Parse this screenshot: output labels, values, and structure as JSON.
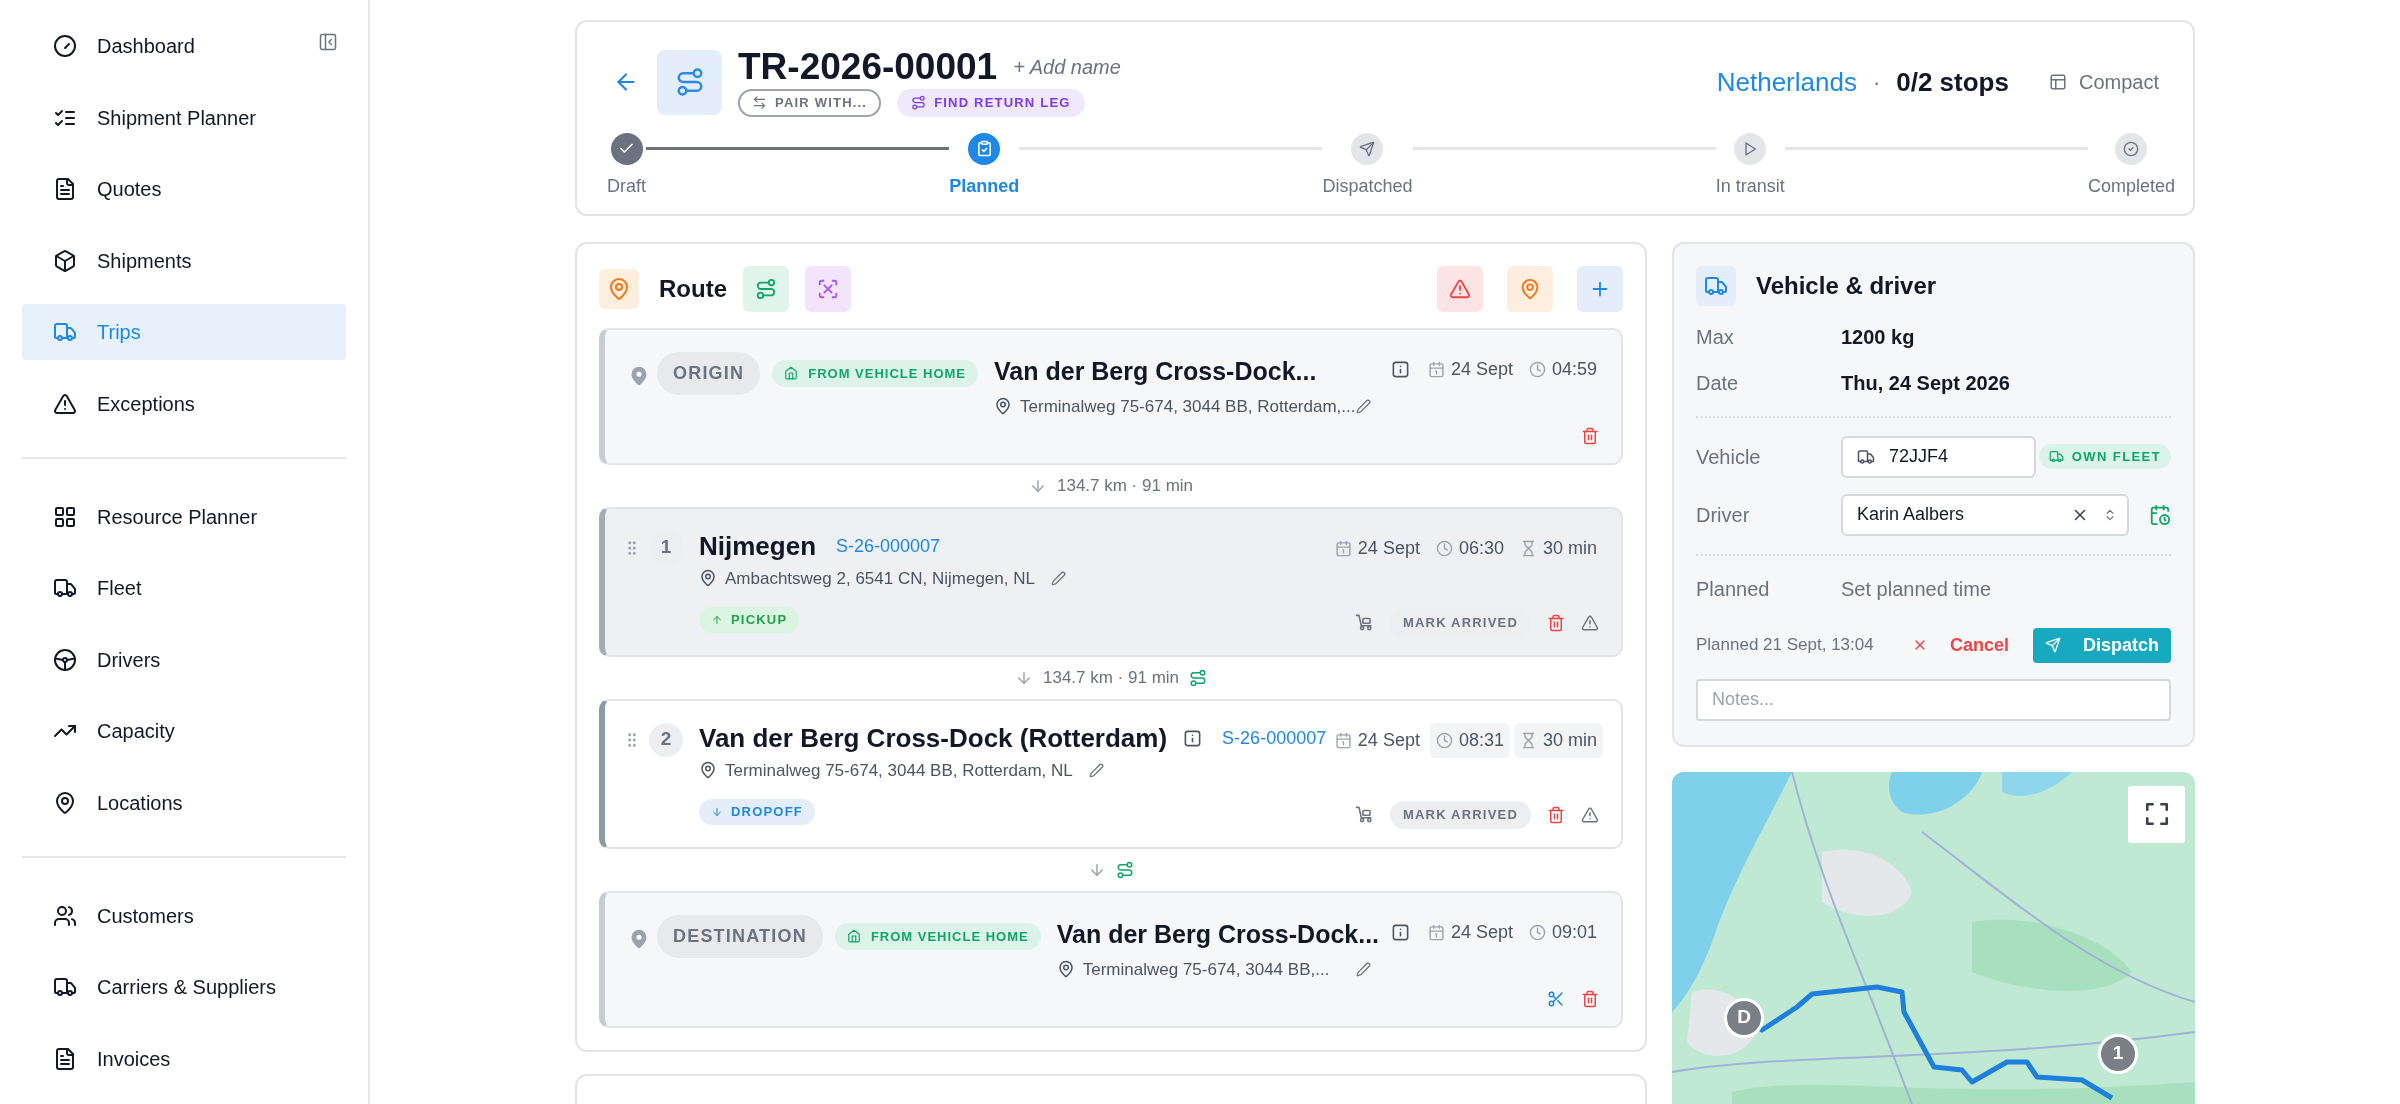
{
  "sidebar": {
    "collapse_button": true,
    "sections": [
      {
        "items": [
          {
            "label": "Dashboard",
            "selected": false
          },
          {
            "label": "Shipment Planner",
            "selected": false
          },
          {
            "label": "Quotes",
            "selected": false
          },
          {
            "label": "Shipments",
            "selected": false
          },
          {
            "label": "Trips",
            "selected": true
          },
          {
            "label": "Exceptions",
            "selected": false
          }
        ]
      },
      {
        "items": [
          {
            "label": "Resource Planner",
            "selected": false
          },
          {
            "label": "Fleet",
            "selected": false
          },
          {
            "label": "Drivers",
            "selected": false
          },
          {
            "label": "Capacity",
            "selected": false
          },
          {
            "label": "Locations",
            "selected": false
          }
        ]
      },
      {
        "items": [
          {
            "label": "Customers",
            "selected": false
          },
          {
            "label": "Carriers & Suppliers",
            "selected": false
          },
          {
            "label": "Invoices",
            "selected": false
          }
        ]
      }
    ]
  },
  "header": {
    "title": "TR-2026-00001",
    "add_name": "+ Add name",
    "pair_button": "PAIR WITH...",
    "return_leg_button": "FIND RETURN LEG",
    "region": "Netherlands",
    "separator": "·",
    "stops": "0/2 stops",
    "view_toggle": "Compact",
    "steps": [
      {
        "label": "Draft",
        "done": true,
        "selected": false
      },
      {
        "label": "Planned",
        "done": false,
        "selected": true
      },
      {
        "label": "Dispatched",
        "done": false,
        "selected": false
      },
      {
        "label": "In transit",
        "done": false,
        "selected": false
      },
      {
        "label": "Completed",
        "done": false,
        "selected": false
      }
    ]
  },
  "route": {
    "title": "Route",
    "items": [
      {
        "kind": "endpoint",
        "role": "ORIGIN",
        "source": "FROM VEHICLE HOME",
        "name": "Van der Berg Cross-Dock...",
        "address": "Terminalweg 75-674, 3044 BB, Rotterdam,...",
        "date": "24 Sept",
        "time": "04:59",
        "split": false
      },
      {
        "kind": "leg",
        "distance": "134.7 km · 91 min",
        "route_icon": false
      },
      {
        "kind": "stop",
        "number": "1",
        "name": "Nijmegen",
        "info": false,
        "shipment": "S-26-000007",
        "address": "Ambachtsweg 2, 6541 CN, Nijmegen, NL",
        "pickup": true,
        "type_label": "PICKUP",
        "date": "24 Sept",
        "time": "06:30",
        "duration": "30 min",
        "action": "MARK ARRIVED",
        "highlight": false
      },
      {
        "kind": "leg",
        "distance": "134.7 km · 91 min",
        "route_icon": true
      },
      {
        "kind": "stop",
        "number": "2",
        "name": "Van der Berg Cross-Dock (Rotterdam)",
        "info": true,
        "shipment": "S-26-000007",
        "address": "Terminalweg 75-674, 3044 BB, Rotterdam, NL",
        "pickup": false,
        "type_label": "DROPOFF",
        "date": "24 Sept",
        "time": "08:31",
        "duration": "30 min",
        "action": "MARK ARRIVED",
        "highlight": true
      },
      {
        "kind": "leg",
        "route_icon": true
      },
      {
        "kind": "endpoint",
        "role": "DESTINATION",
        "source": "FROM VEHICLE HOME",
        "name": "Van der Berg Cross-Dock...",
        "address": "Terminalweg 75-674, 3044 BB,...",
        "date": "24 Sept",
        "time": "09:01",
        "split": true
      }
    ]
  },
  "vehicle_panel": {
    "title": "Vehicle & driver",
    "rows": [
      {
        "label": "Max",
        "value": "1200 kg"
      },
      {
        "label": "Date",
        "value": "Thu, 24 Sept 2026"
      }
    ],
    "vehicle_label": "Vehicle",
    "vehicle": "72JJF4",
    "fleet_badge": "OWN FLEET",
    "driver_label": "Driver",
    "driver": "Karin Aalbers",
    "planned_label": "Planned",
    "planned_value": "Set planned time",
    "planned_note": "Planned 21 Sept, 13:04",
    "cancel": "Cancel",
    "dispatch": "Dispatch",
    "notes_placeholder": "Notes..."
  },
  "map": {
    "kind": "picture",
    "markers": [
      {
        "label": "D"
      },
      {
        "label": "1"
      }
    ]
  }
}
